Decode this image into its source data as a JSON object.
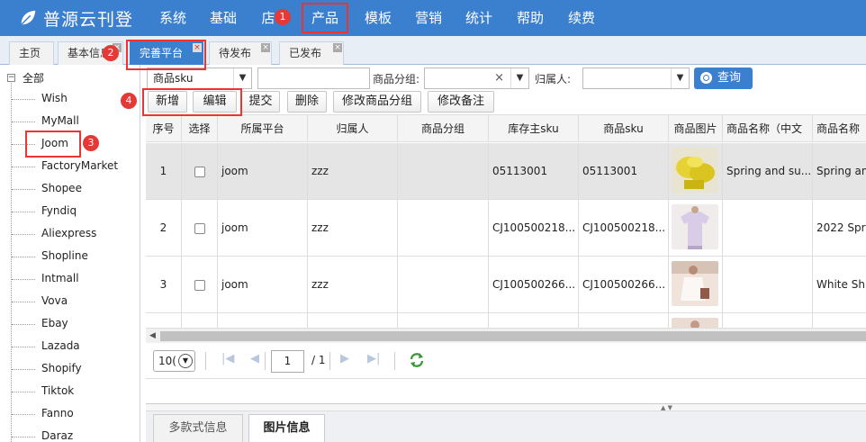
{
  "app": {
    "title": "普源云刊登"
  },
  "nav": {
    "items": [
      {
        "label": "系统"
      },
      {
        "label": "基础"
      },
      {
        "label": "店"
      },
      {
        "label": "产品"
      },
      {
        "label": "模板"
      },
      {
        "label": "营销"
      },
      {
        "label": "统计"
      },
      {
        "label": "帮助"
      },
      {
        "label": "续费"
      }
    ]
  },
  "steps": [
    "1",
    "2",
    "3",
    "4"
  ],
  "tabs": [
    {
      "label": "主页"
    },
    {
      "label": "基本信息"
    },
    {
      "label": "完善平台"
    },
    {
      "label": "待发布"
    },
    {
      "label": "已发布"
    }
  ],
  "tab_close_glyph": "×",
  "tree": {
    "root": "全部",
    "expander": "⊟",
    "items": [
      "Wish",
      "MyMall",
      "Joom",
      "FactoryMarket",
      "Shopee",
      "Fyndiq",
      "Aliexpress",
      "Shopline",
      "Intmall",
      "Vova",
      "Ebay",
      "Lazada",
      "Shopify",
      "Tiktok",
      "Fanno",
      "Daraz"
    ]
  },
  "filter": {
    "field_select": "商品sku",
    "group_label": "商品分组:",
    "group_clear": "×",
    "owner_label": "归属人:",
    "query_label": "查询"
  },
  "actions": {
    "add": "新增",
    "edit": "编辑",
    "submit": "提交",
    "delete": "删除",
    "modify_group": "修改商品分组",
    "modify_note": "修改备注"
  },
  "grid": {
    "columns": [
      "序号",
      "选择",
      "所属平台",
      "归属人",
      "商品分组",
      "库存主sku",
      "商品sku",
      "商品图片",
      "商品名称（中文",
      "商品名称"
    ],
    "rows": [
      {
        "no": "1",
        "platform": "joom",
        "owner": "zzz",
        "group": "",
        "main_sku": "05113001",
        "sku": "05113001",
        "image": "yellow-ruffle-dress-image",
        "name_cn": "Spring and su...",
        "name": "Spring an",
        "selected": true
      },
      {
        "no": "2",
        "platform": "joom",
        "owner": "zzz",
        "group": "",
        "main_sku": "CJ100500218...",
        "sku": "CJ100500218...",
        "image": "lavender-tshirt-image",
        "name_cn": "",
        "name": "2022 Spri",
        "selected": false
      },
      {
        "no": "3",
        "platform": "joom",
        "owner": "zzz",
        "group": "",
        "main_sku": "CJ100500266...",
        "sku": "CJ100500266...",
        "image": "white-shirt-model-image",
        "name_cn": "",
        "name": "White Shi",
        "selected": false
      }
    ]
  },
  "pager": {
    "page_size": "10(",
    "page": "1",
    "total": "/ 1",
    "icons": [
      "first-page-icon",
      "prev-page-icon",
      "next-page-icon",
      "last-page-icon",
      "refresh-icon"
    ]
  },
  "bottom_tabs": [
    {
      "label": "多款式信息"
    },
    {
      "label": "图片信息"
    }
  ],
  "colors": {
    "brand": "#3b7fcf",
    "highlight": "#e33333",
    "badge": "#e53935"
  }
}
